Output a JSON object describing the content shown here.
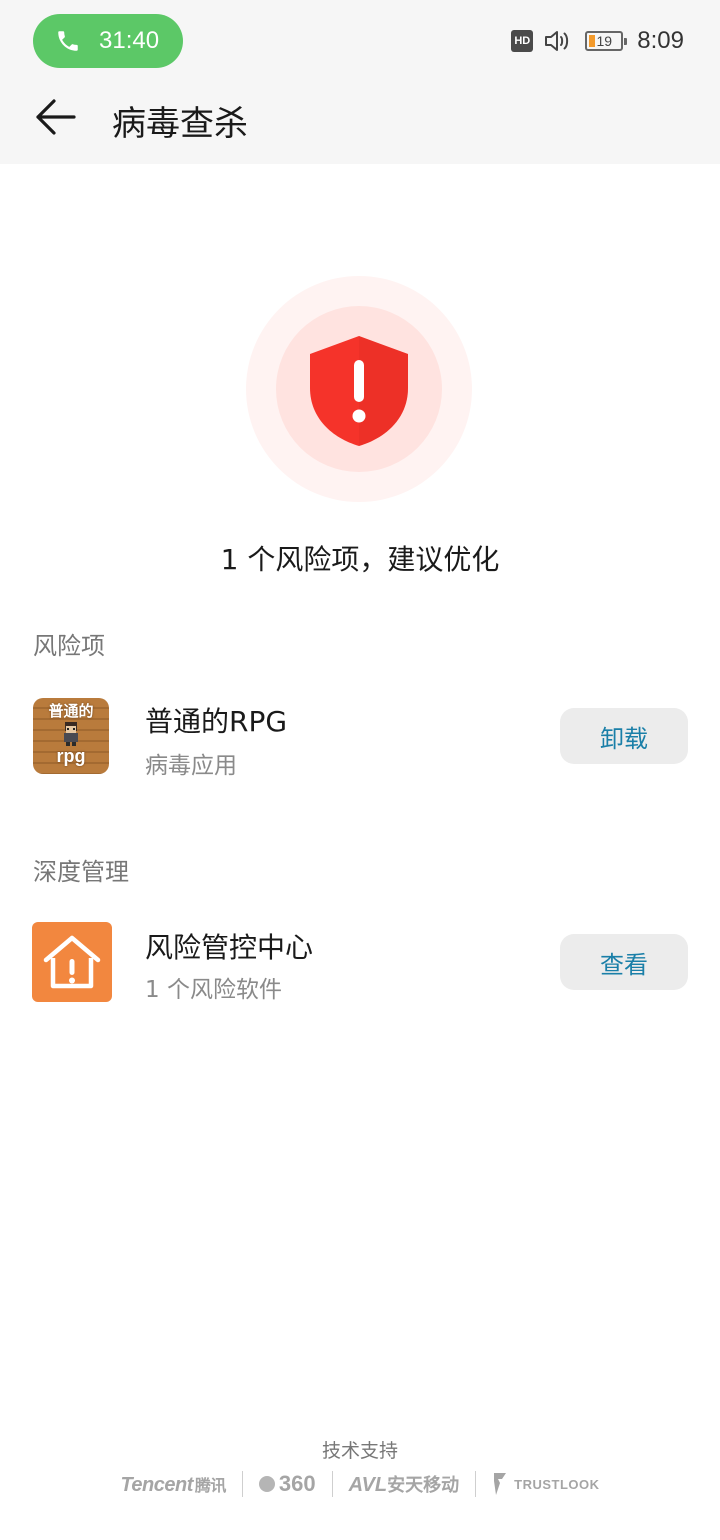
{
  "status_bar": {
    "call_timer": "31:40",
    "hd_badge": "HD",
    "battery_level": "19",
    "clock": "8:09"
  },
  "header": {
    "title": "病毒查杀"
  },
  "summary": {
    "text": "1 个风险项，建议优化"
  },
  "risk_section": {
    "title": "风险项",
    "items": [
      {
        "icon_text_top": "普通的",
        "icon_text_bottom": "rpg",
        "name": "普通的RPG",
        "subtitle": "病毒应用",
        "action_label": "卸载"
      }
    ]
  },
  "deep_section": {
    "title": "深度管理",
    "items": [
      {
        "name": "风险管控中心",
        "subtitle": "1 个风险软件",
        "action_label": "查看"
      }
    ]
  },
  "footer": {
    "title": "技术支持",
    "partners": [
      {
        "name_en": "Tencent",
        "name_cn": "腾讯"
      },
      {
        "name_en": "360"
      },
      {
        "name_en": "AVL",
        "name_cn": "安天移动"
      },
      {
        "name_en": "TRUSTLOOK"
      }
    ]
  },
  "colors": {
    "call_pill": "#5cc867",
    "shield_red": "#f5332a",
    "action_text": "#1a7fa8",
    "risk_center_icon": "#f2873f"
  }
}
